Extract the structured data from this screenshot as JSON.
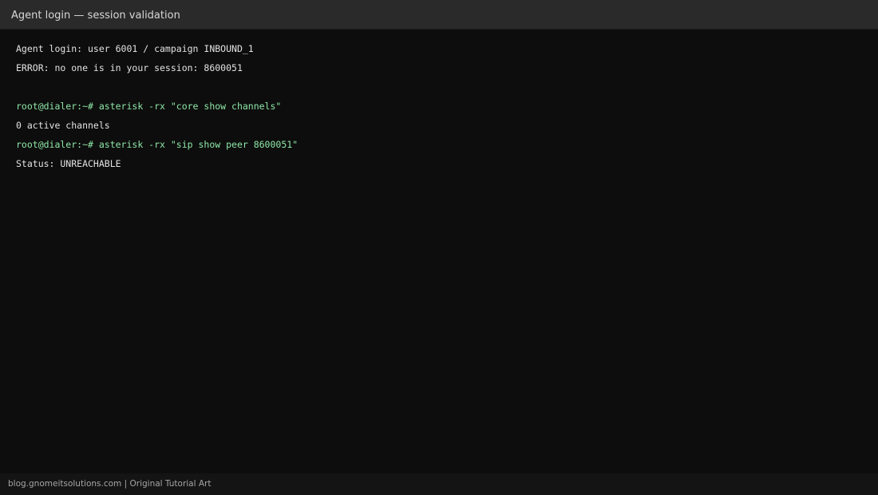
{
  "window": {
    "title": "Agent login — session validation"
  },
  "terminal": {
    "lines": [
      {
        "text": "Agent login: user 6001 / campaign INBOUND_1",
        "kind": "output"
      },
      {
        "text": "ERROR: no one is in your session: 8600051",
        "kind": "output"
      },
      {
        "text": "",
        "kind": "blank"
      },
      {
        "text": "root@dialer:~# asterisk -rx \"core show channels\"",
        "kind": "command"
      },
      {
        "text": "0 active channels",
        "kind": "output"
      },
      {
        "text": "root@dialer:~# asterisk -rx \"sip show peer 8600051\"",
        "kind": "command"
      },
      {
        "text": "Status: UNREACHABLE",
        "kind": "output"
      }
    ]
  },
  "footer": {
    "text": "blog.gnomeitsolutions.com | Original Tutorial Art"
  },
  "colors": {
    "background": "#0d0d0d",
    "titlebar": "#2a2a2a",
    "output_text": "#e2e2e2",
    "command_text": "#8ee6a6",
    "footer_text": "#a6a6a6"
  }
}
